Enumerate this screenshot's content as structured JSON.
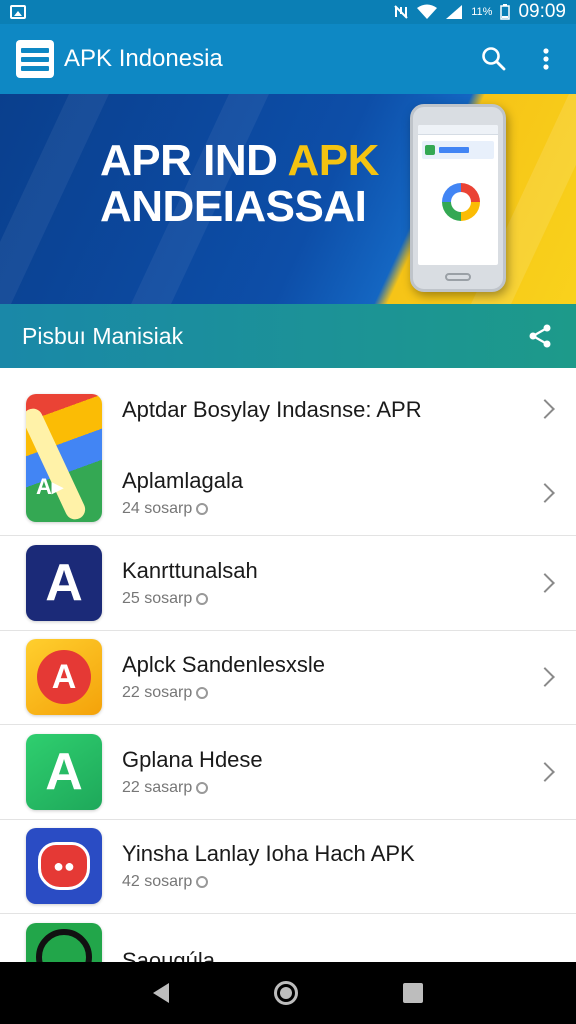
{
  "status_bar": {
    "battery": "11%",
    "time": "09:09"
  },
  "app_bar": {
    "title": "APK Indonesia"
  },
  "banner": {
    "line1_part1": "APR IND ",
    "line1_part2": "APK",
    "line2": "ANDEIASSAI"
  },
  "section": {
    "title": "Pisbuı Manisiak"
  },
  "list": {
    "items": [
      {
        "title": "Aptdar Bosylay Indasnse: APR",
        "subtitle": ""
      },
      {
        "title": "Aplamlagala",
        "subtitle": "24 sosarp"
      },
      {
        "title": "Kanrttunalsah",
        "subtitle": "25 sosarp"
      },
      {
        "title": "Aplck Sandenlesxsle",
        "subtitle": "22 sosarp"
      },
      {
        "title": "Gplana Hdese",
        "subtitle": "22 sasarp"
      },
      {
        "title": "Yinsha Lanlay Ioha Hach APK",
        "subtitle": "42 sosarp"
      },
      {
        "title": "Saougúla",
        "subtitle": ""
      }
    ]
  },
  "colors": {
    "status_bar": "#0b7fb5",
    "app_bar": "#0e88c4",
    "section_header": "#1d9a8a",
    "banner_accent": "#f4c311"
  },
  "icons": {
    "search": "search-icon",
    "overflow": "more-vert-icon",
    "share": "share-icon"
  }
}
